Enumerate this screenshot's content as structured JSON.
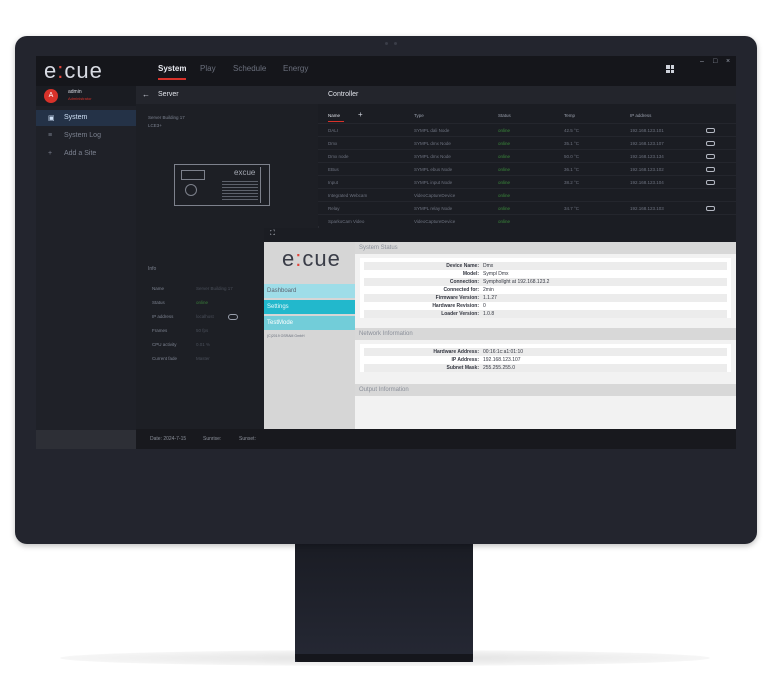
{
  "app": {
    "logo": "excue",
    "nav_tabs": [
      {
        "label": "System",
        "active": true
      },
      {
        "label": "Play",
        "active": false
      },
      {
        "label": "Schedule",
        "active": false
      },
      {
        "label": "Energy",
        "active": false
      }
    ],
    "window_controls": [
      "–",
      "□",
      "×"
    ]
  },
  "user": {
    "initial": "A",
    "name": "admin",
    "role": "Administrator"
  },
  "sidebar": {
    "items": [
      {
        "label": "System",
        "icon": "system-icon",
        "active": true
      },
      {
        "label": "System Log",
        "icon": "menu-icon",
        "active": false
      },
      {
        "label": "Add a Site",
        "icon": "plus-icon",
        "active": false
      }
    ]
  },
  "server": {
    "title": "Server",
    "name": "Server Building 17",
    "sub": "LCE3+",
    "device_logo": "excue",
    "info_title": "Info",
    "info": [
      {
        "key": "Name",
        "value": "Server Building 17"
      },
      {
        "key": "Status",
        "value": "online"
      },
      {
        "key": "IP address",
        "value": "localhost"
      },
      {
        "key": "Frames",
        "value": "50 fps"
      },
      {
        "key": "CPU activity",
        "value": "0.01 %"
      },
      {
        "key": "Current fade",
        "value": "Master"
      }
    ]
  },
  "controller": {
    "title": "Controller",
    "columns": [
      "Name",
      "Type",
      "Status",
      "Temp",
      "IP address"
    ],
    "rows": [
      {
        "name": "DALI",
        "type": "SYMPL dali Node",
        "status": "online",
        "temp": "42.5 °C",
        "ip": "192.168.123.101",
        "link": true
      },
      {
        "name": "Dmx",
        "type": "SYMPL dmx Node",
        "status": "online",
        "temp": "35.1 °C",
        "ip": "192.168.123.107",
        "link": true
      },
      {
        "name": "Dmx node",
        "type": "SYMPL dmx Node",
        "status": "online",
        "temp": "50.0 °C",
        "ip": "192.168.123.134",
        "link": true
      },
      {
        "name": "EBus",
        "type": "SYMPL ebus Node",
        "status": "online",
        "temp": "36.1 °C",
        "ip": "192.168.123.102",
        "link": true
      },
      {
        "name": "Input",
        "type": "SYMPL input Node",
        "status": "online",
        "temp": "38.2 °C",
        "ip": "192.168.123.104",
        "link": true
      },
      {
        "name": "Integrated Webcam",
        "type": "VideoCaptureDevice",
        "status": "online",
        "temp": "",
        "ip": "",
        "link": false
      },
      {
        "name": "Relay",
        "type": "SYMPL relay Node",
        "status": "online",
        "temp": "34.7 °C",
        "ip": "192.168.123.103",
        "link": true
      },
      {
        "name": "SparkoCam Video",
        "type": "VideoCaptureDevice",
        "status": "online",
        "temp": "",
        "ip": "",
        "link": false
      }
    ]
  },
  "status_panel": {
    "logo": "excue",
    "menu": [
      "Dashboard",
      "Settings",
      "TestMode"
    ],
    "copyright": "(C)2019 OSRAM GmbH",
    "system_status": {
      "title": "System Status",
      "rows": [
        {
          "key": "Device Name:",
          "value": "Dmx"
        },
        {
          "key": "Model:",
          "value": "Sympl Dmx"
        },
        {
          "key": "Connection:",
          "value": "Symphollght at 192.168.123.2"
        },
        {
          "key": "Connected for:",
          "value": "2min"
        },
        {
          "key": "Firmware Version:",
          "value": "1.1.27"
        },
        {
          "key": "Hardware Revision:",
          "value": "0"
        },
        {
          "key": "Loader Version:",
          "value": "1.0.8"
        }
      ]
    },
    "network_information": {
      "title": "Network Information",
      "rows": [
        {
          "key": "Hardware Address:",
          "value": "00:16:1c:a1:01:10"
        },
        {
          "key": "IP Address:",
          "value": "192.168.123.107"
        },
        {
          "key": "Subnet Mask:",
          "value": "255.255.255.0"
        }
      ]
    },
    "output_information": {
      "title": "Output Information"
    }
  },
  "statusbar": {
    "date": "Date: 2024-7-15",
    "sunrise": "Sunrise:",
    "sunset": "Sunset:"
  }
}
